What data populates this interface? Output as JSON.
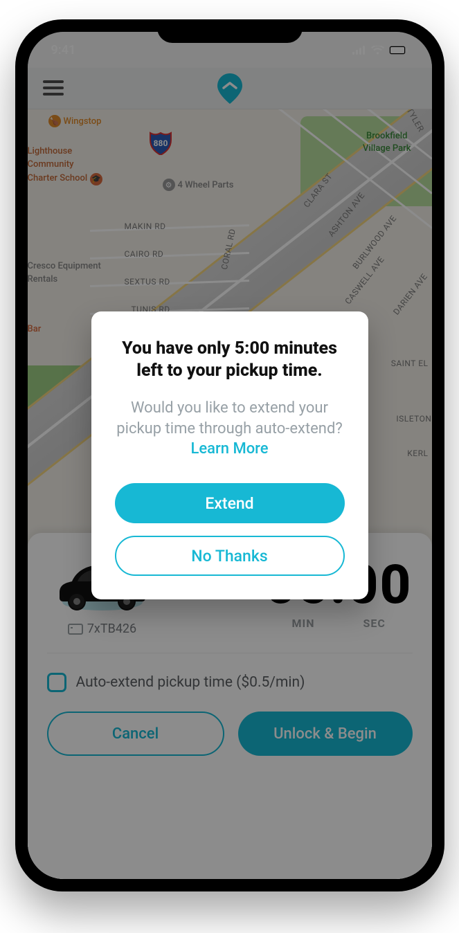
{
  "statusbar": {
    "time": "9:41"
  },
  "map": {
    "poi": {
      "wingstop": "Wingstop",
      "school_l1": "Lighthouse",
      "school_l2": "Community",
      "school_l3": "Charter School",
      "fourwheel": "4 Wheel Parts",
      "park_l1": "Brookfield",
      "park_l2": "Village Park",
      "cresco_l1": "Cresco Equipment",
      "cresco_l2": "Rentals",
      "bar": "Bar"
    },
    "roads": {
      "makin": "MAKIN RD",
      "cairo": "CAIRO RD",
      "sextus": "SEXTUS RD",
      "tunis": "TUNIS RD",
      "coral": "CORAL RD",
      "clara": "CLARA ST",
      "ashton": "ASHTON AVE",
      "burlwood": "BURLWOOD AVE",
      "caswell": "CASWELL AVE",
      "darien": "DARIEN AVE",
      "saintel": "SAINT EL",
      "isleton": "ISLETON",
      "kerl": "KERL",
      "tyler": "TYLER"
    },
    "shield": "880"
  },
  "sheet": {
    "plate": "7xTB426",
    "timer": "05:00",
    "min_label": "MIN",
    "sec_label": "SEC",
    "auto_extend_label": "Auto-extend pickup time ($0.5/min)",
    "cancel": "Cancel",
    "unlock": "Unlock & Begin"
  },
  "modal": {
    "title": "You have only 5:00 minutes left to your pickup time.",
    "body_prefix": "Would you like to extend your pickup time through auto-extend? ",
    "learn_more": "Learn More",
    "extend": "Extend",
    "no_thanks": "No Thanks"
  }
}
